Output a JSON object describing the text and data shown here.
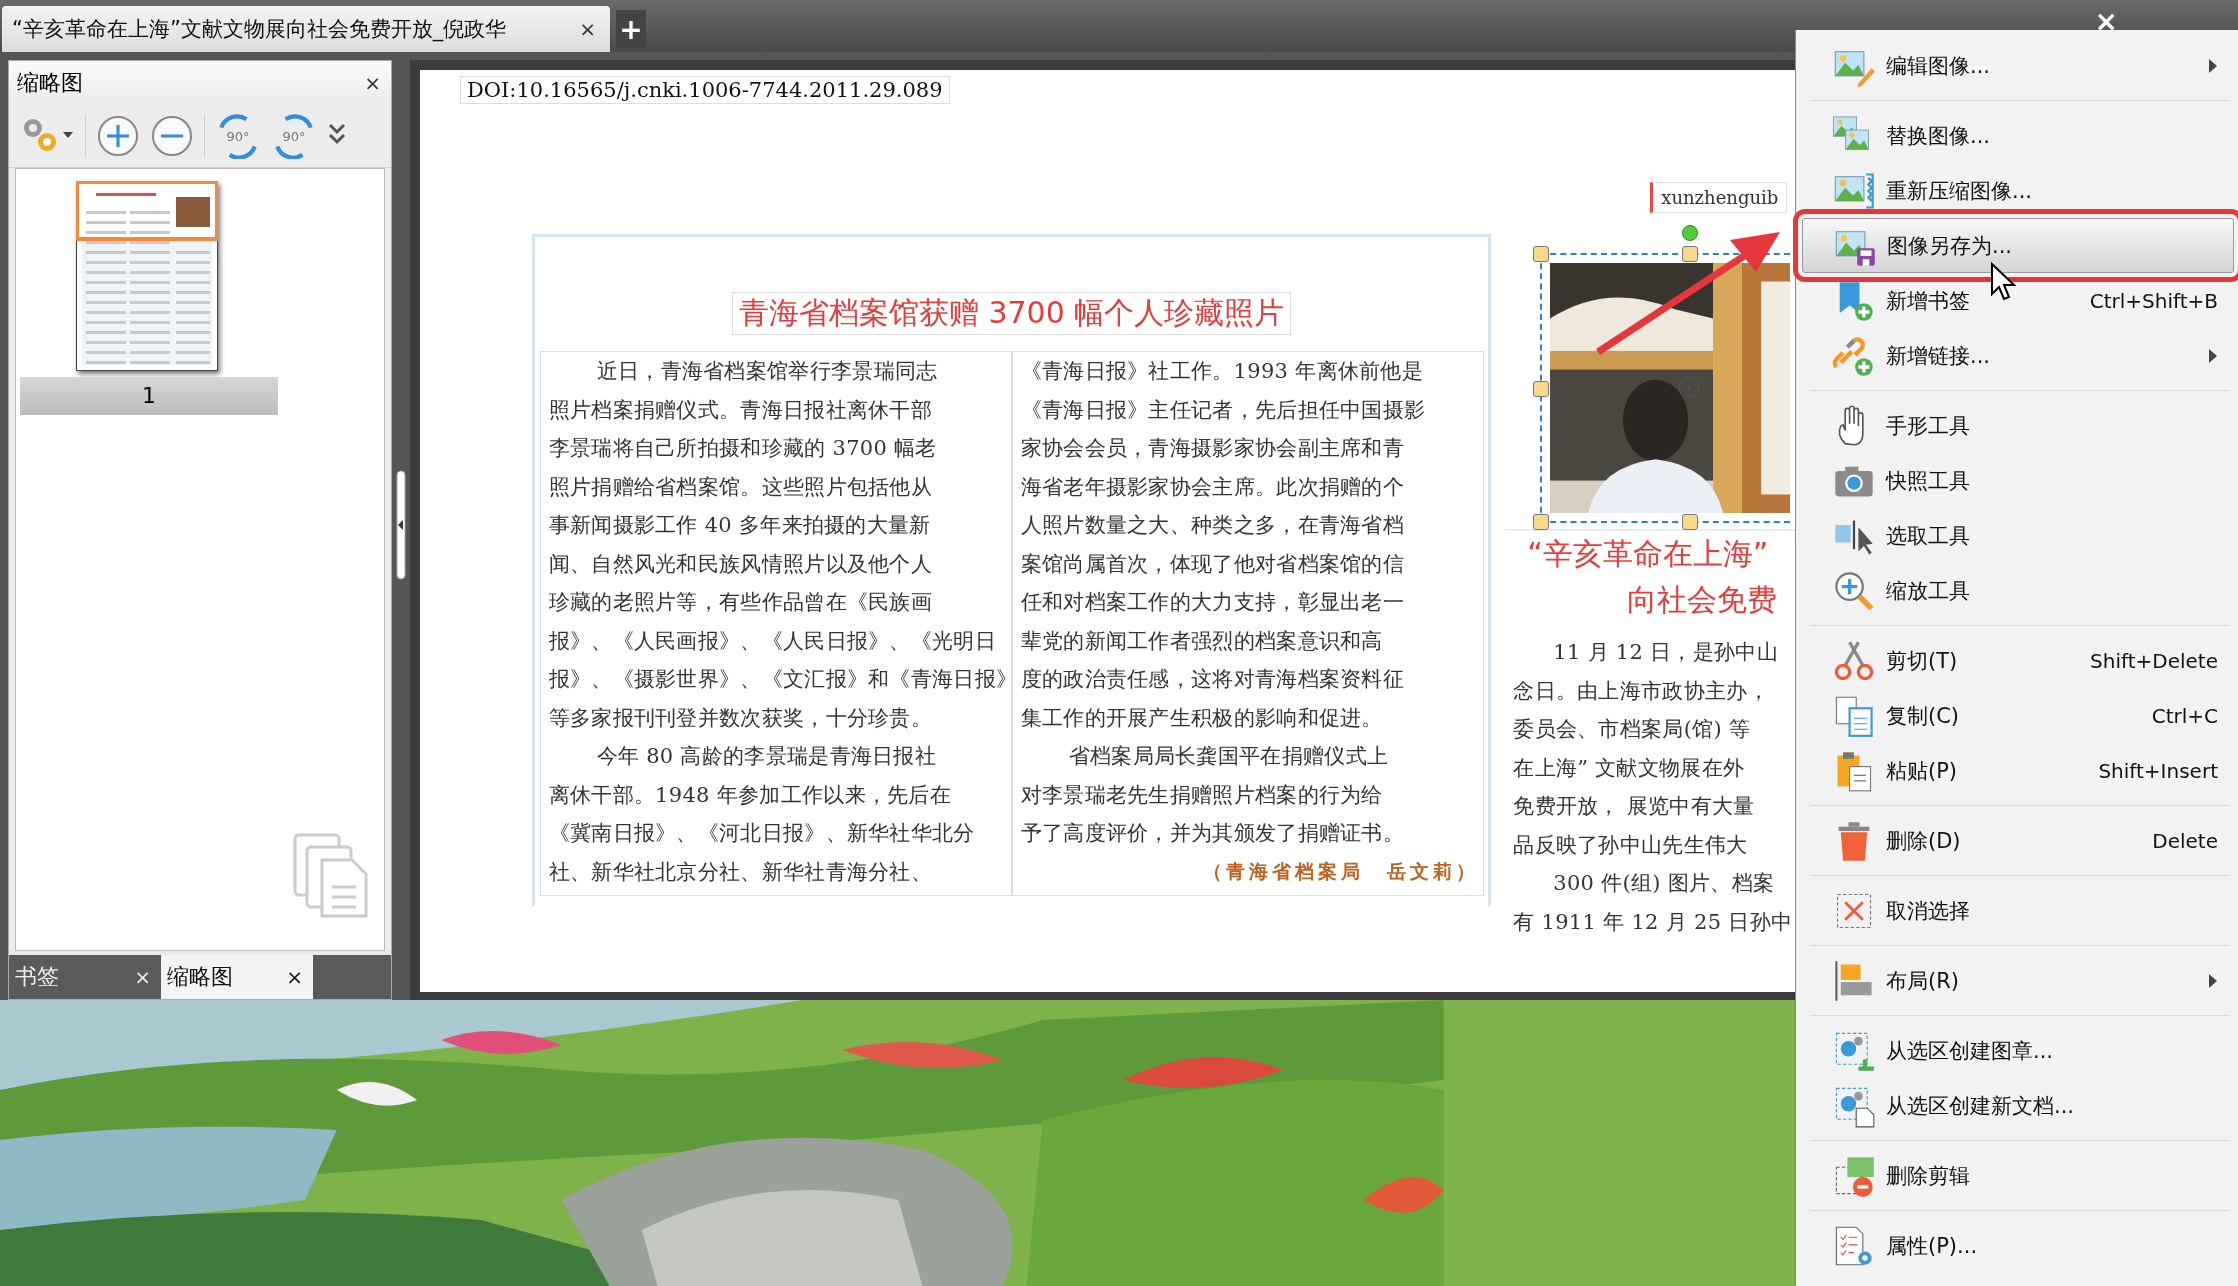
{
  "tab": {
    "title": "“辛亥革命在上海”文献文物展向社会免费开放_倪政华",
    "close": "×",
    "new_tab": "+"
  },
  "window_close": "×",
  "sidebar": {
    "title": "缩略图",
    "close": "×",
    "toolbar": {
      "rotate_left": "90°",
      "rotate_right": "90°"
    },
    "thumbnails": [
      {
        "page": "1",
        "selected": true
      }
    ],
    "tabs": [
      {
        "label": "书签",
        "close": "×",
        "selected": false
      },
      {
        "label": "缩略图",
        "close": "×",
        "selected": true
      }
    ]
  },
  "document": {
    "doi": "DOI:10.16565/j.cnki.1006-7744.2011.29.089",
    "article": {
      "title": "青海省档案馆获赠 3700 幅个人珍藏照片",
      "columns": [
        [
          {
            "text": "近日，青海省档案馆举行李景瑞同志",
            "indent": true
          },
          {
            "text": "照片档案捐赠仪式。青海日报社离休干部",
            "indent": false
          },
          {
            "text": "李景瑞将自己所拍摄和珍藏的 3700 幅老",
            "indent": false
          },
          {
            "text": "照片捐赠给省档案馆。这些照片包括他从",
            "indent": false
          },
          {
            "text": "事新闻摄影工作 40 多年来拍摄的大量新",
            "indent": false
          },
          {
            "text": "闻、自然风光和民族风情照片以及他个人",
            "indent": false
          },
          {
            "text": "珍藏的老照片等，有些作品曾在《民族画",
            "indent": false
          },
          {
            "text": "报》、《人民画报》、《人民日报》、《光明日",
            "indent": false
          },
          {
            "text": "报》、《摄影世界》、《文汇报》和《青海日报》",
            "indent": false
          },
          {
            "text": "等多家报刊刊登并数次获奖，十分珍贵。",
            "indent": false
          },
          {
            "text": "今年 80 高龄的李景瑞是青海日报社",
            "indent": true
          },
          {
            "text": "离休干部。1948 年参加工作以来，先后在",
            "indent": false
          },
          {
            "text": "《冀南日报》、《河北日报》、新华社华北分",
            "indent": false
          },
          {
            "text": "社、新华社北京分社、新华社青海分社、",
            "indent": false
          }
        ],
        [
          {
            "text": "《青海日报》社工作。1993 年离休前他是",
            "indent": false
          },
          {
            "text": "《青海日报》主任记者，先后担任中国摄影",
            "indent": false
          },
          {
            "text": "家协会会员，青海摄影家协会副主席和青",
            "indent": false
          },
          {
            "text": "海省老年摄影家协会主席。此次捐赠的个",
            "indent": false
          },
          {
            "text": "人照片数量之大、种类之多，在青海省档",
            "indent": false
          },
          {
            "text": "案馆尚属首次，体现了他对省档案馆的信",
            "indent": false
          },
          {
            "text": "任和对档案工作的大力支持，彰显出老一",
            "indent": false
          },
          {
            "text": "辈党的新闻工作者强烈的档案意识和高",
            "indent": false
          },
          {
            "text": "度的政治责任感，这将对青海档案资料征",
            "indent": false
          },
          {
            "text": "集工作的开展产生积极的影响和促进。",
            "indent": false
          },
          {
            "text": "省档案局局长龚国平在捐赠仪式上",
            "indent": true
          },
          {
            "text": "对李景瑞老先生捐赠照片档案的行为给",
            "indent": false
          },
          {
            "text": "予了高度评价，并为其颁发了捐赠证书。",
            "indent": false
          }
        ]
      ],
      "byline": "（青海省档案局　岳文莉）"
    },
    "second_article": {
      "tag": "xunzhenguib",
      "image": {
        "kind": "picture",
        "selected": true
      },
      "title_lines": [
        "“辛亥革命在上海”",
        "向社会免费"
      ],
      "lines": [
        {
          "text": "11 月 12 日，是孙中山",
          "indent": true
        },
        {
          "text": "念日。由上海市政协主办，",
          "indent": false
        },
        {
          "text": "委员会、市档案局(馆) 等",
          "indent": false
        },
        {
          "text": "在上海” 文献文物展在外",
          "indent": false
        },
        {
          "text": "免费开放， 展览中有大量",
          "indent": false
        },
        {
          "text": "品反映了孙中山先生伟大",
          "indent": false
        },
        {
          "text": "300 件(组) 图片、档案",
          "indent": true
        },
        {
          "text": "有 1911 年 12 月 25 日孙中",
          "indent": false
        }
      ]
    }
  },
  "context_menu": [
    {
      "kind": "item",
      "label": "编辑图像...",
      "submenu": true,
      "selected": false
    },
    {
      "kind": "separator"
    },
    {
      "kind": "item",
      "label": "替换图像...",
      "submenu": false,
      "selected": false
    },
    {
      "kind": "item",
      "label": "重新压缩图像...",
      "submenu": false,
      "selected": false
    },
    {
      "kind": "item",
      "label": "图像另存为...",
      "submenu": false,
      "selected": true
    },
    {
      "kind": "item",
      "label": "新增书签",
      "shortcut": "Ctrl+Shift+B",
      "submenu": false,
      "selected": false
    },
    {
      "kind": "item",
      "label": "新增链接...",
      "submenu": true,
      "selected": false
    },
    {
      "kind": "separator"
    },
    {
      "kind": "item",
      "label": "手形工具",
      "submenu": false,
      "selected": false
    },
    {
      "kind": "item",
      "label": "快照工具",
      "submenu": false,
      "selected": false
    },
    {
      "kind": "item",
      "label": "选取工具",
      "submenu": false,
      "selected": false
    },
    {
      "kind": "item",
      "label": "缩放工具",
      "submenu": false,
      "selected": false
    },
    {
      "kind": "separator"
    },
    {
      "kind": "item",
      "label": "剪切(T)",
      "shortcut": "Shift+Delete",
      "submenu": false,
      "selected": false
    },
    {
      "kind": "item",
      "label": "复制(C)",
      "shortcut": "Ctrl+C",
      "submenu": false,
      "selected": false
    },
    {
      "kind": "item",
      "label": "粘贴(P)",
      "shortcut": "Shift+Insert",
      "submenu": false,
      "selected": false
    },
    {
      "kind": "separator"
    },
    {
      "kind": "item",
      "label": "删除(D)",
      "shortcut": "Delete",
      "submenu": false,
      "selected": false
    },
    {
      "kind": "separator"
    },
    {
      "kind": "item",
      "label": "取消选择",
      "submenu": false,
      "selected": false
    },
    {
      "kind": "separator"
    },
    {
      "kind": "item",
      "label": "布局(R)",
      "submenu": true,
      "selected": false
    },
    {
      "kind": "separator"
    },
    {
      "kind": "item",
      "label": "从选区创建图章...",
      "submenu": false,
      "selected": false
    },
    {
      "kind": "item",
      "label": "从选区创建新文档...",
      "submenu": false,
      "selected": false
    },
    {
      "kind": "separator"
    },
    {
      "kind": "item",
      "label": "删除剪辑",
      "submenu": false,
      "selected": false
    },
    {
      "kind": "separator"
    },
    {
      "kind": "item",
      "label": "属性(P)...",
      "submenu": false,
      "selected": false
    }
  ]
}
